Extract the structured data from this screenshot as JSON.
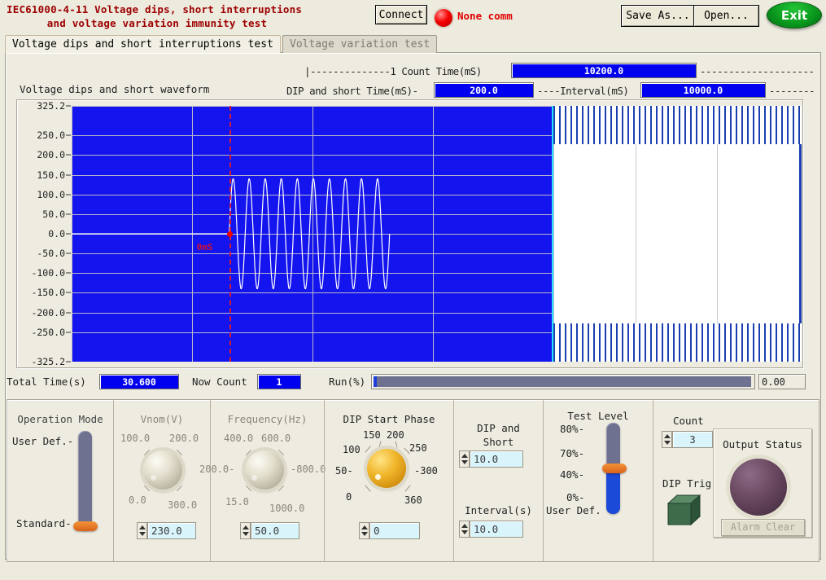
{
  "window": {
    "title_line1": "IEC61000-4-11 Voltage dips, short interruptions",
    "title_line2": "and voltage variation immunity test",
    "connect_label": "Connect",
    "comm_status": "None comm",
    "comm_led_color": "#f60000",
    "save_as_label": "Save As...",
    "open_label": "Open...",
    "exit_label": "Exit",
    "exit_color": "#0a9a1e"
  },
  "tabs": [
    {
      "label": "Voltage dips and short interruptions test",
      "active": true
    },
    {
      "label": "Voltage variation test",
      "active": false
    }
  ],
  "timing": {
    "count_time_lead": "|--------------1 Count Time(mS)",
    "count_time_value": "10200.0",
    "count_time_trail": "--------------------",
    "dip_time_lead": "DIP and short Time(mS)-",
    "dip_time_value": "200.0",
    "interval_mid": "----Interval(mS)",
    "interval_value": "10000.0",
    "interval_trail": "--------",
    "field_color": "#0000f0"
  },
  "chart": {
    "caption": "Voltage dips and short waveform",
    "cursor_label": "0mS",
    "cursor_color": "#d01030",
    "plot_bg": "#1414ef",
    "trace_color": "#ffffff"
  },
  "chart_data": {
    "type": "line",
    "title": "Voltage dips and short waveform",
    "xlabel": "",
    "ylabel": "",
    "ylim": [
      -325.2,
      325.2
    ],
    "yticks": [
      "325.2",
      "250.0",
      "200.0",
      "150.0",
      "100.0",
      "50.0",
      "0.0",
      "-50.0",
      "-100.0",
      "-150.0",
      "-200.0",
      "-250.0",
      "-325.2"
    ],
    "ytick_values": [
      325.2,
      250.0,
      200.0,
      150.0,
      100.0,
      50.0,
      0.0,
      -50.0,
      -100.0,
      -150.0,
      -200.0,
      -250.0,
      -325.2
    ],
    "grid": true,
    "legend": "none",
    "annotations": [
      {
        "text": "0mS",
        "type": "cursor",
        "x_fraction": 0.327,
        "color": "#d01030"
      }
    ],
    "series": [
      {
        "name": "Voltage waveform",
        "color": "#ffffff",
        "description": "Flat zero line until the 0mS cursor, then a 50 Hz sinusoid of amplitude ~140 V running for about 10 cycles, then a dense compressed sinusoid of amplitude ~325 V for the rest of the record",
        "segments": [
          {
            "region": "pre-dip",
            "x_start_fraction": 0.0,
            "x_end_fraction": 0.327,
            "amplitude": 0,
            "cycles": 0
          },
          {
            "region": "dip",
            "x_start_fraction": 0.327,
            "x_end_fraction": 0.66,
            "amplitude": 140,
            "cycles": 10
          },
          {
            "region": "nominal-compressed",
            "x_start_fraction": 0.66,
            "x_end_fraction": 1.0,
            "amplitude": 325,
            "cycles": 120
          }
        ]
      }
    ]
  },
  "status": {
    "total_time_label": "Total Time(s)",
    "total_time_value": "30.600",
    "now_count_label": "Now Count",
    "now_count_value": "1",
    "run_label": "Run(%)",
    "run_value": "0.00",
    "run_percent": 0
  },
  "controls": {
    "operation_mode": {
      "title": "Operation Mode",
      "top_label": "User Def.-",
      "bottom_label": "Standard-",
      "selected": "Standard"
    },
    "vnom": {
      "title": "Vnom(V)",
      "scale": [
        "100.0",
        "200.0",
        "0.0",
        "300.0"
      ],
      "value": "230.0"
    },
    "frequency": {
      "title": "Frequency(Hz)",
      "scale": [
        "400.0",
        "600.0",
        "200.0-",
        "-800.0",
        "15.0",
        "1000.0"
      ],
      "value": "50.0"
    },
    "dip_start_phase": {
      "title": "DIP Start Phase",
      "scale": [
        "150",
        "200",
        "100",
        "250",
        "50-",
        "-300",
        "0",
        "360"
      ],
      "value": "0"
    },
    "dip_and_short": {
      "title_line1": "DIP and",
      "title_line2": "Short",
      "value": "10.0"
    },
    "interval": {
      "title": "Interval(s)",
      "value": "10.0"
    },
    "test_level": {
      "title": "Test Level",
      "ticks": [
        "80%-",
        "70%-",
        "40%-",
        "0%-"
      ],
      "user_def_label": "User Def. -",
      "selected": "40%"
    },
    "count": {
      "title": "Count",
      "value": "3"
    },
    "dip_trig": {
      "label": "DIP Trig"
    },
    "output_status": {
      "title": "Output Status",
      "alarm_clear_label": "Alarm Clear",
      "led_color": "#6b4a62"
    }
  }
}
